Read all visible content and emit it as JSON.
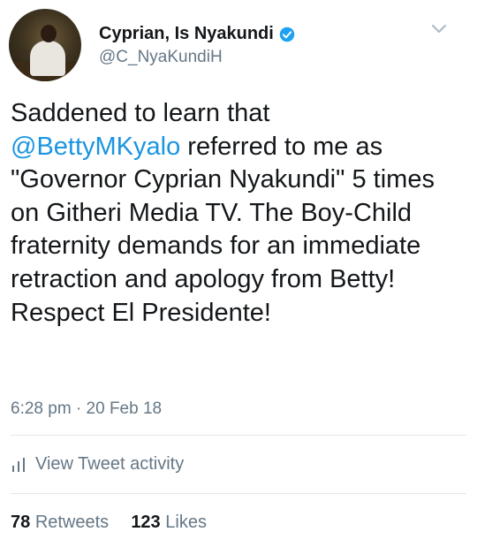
{
  "author": {
    "display_name": "Cyprian, Is Nyakundi",
    "handle": "@C_NyaKundiH"
  },
  "tweet": {
    "text_before_mention": "Saddened to learn that",
    "mention": "@BettyMKyalo",
    "text_after_mention": " referred to me as \"Governor Cyprian Nyakundi\" 5 times on Githeri Media TV. The Boy-Child fraternity  demands for an immediate retraction and apology from Betty! Respect  El Presidente!",
    "timestamp": "6:28 pm · 20 Feb 18"
  },
  "activity": {
    "label": "View Tweet activity"
  },
  "stats": {
    "retweets_count": "78",
    "retweets_label": "Retweets",
    "likes_count": "123",
    "likes_label": "Likes"
  },
  "colors": {
    "link": "#1b95e0",
    "secondary_text": "#657786",
    "verified_badge": "#1da1f2"
  },
  "icons": [
    "verified-badge-icon",
    "chevron-down-icon",
    "bar-chart-icon"
  ]
}
